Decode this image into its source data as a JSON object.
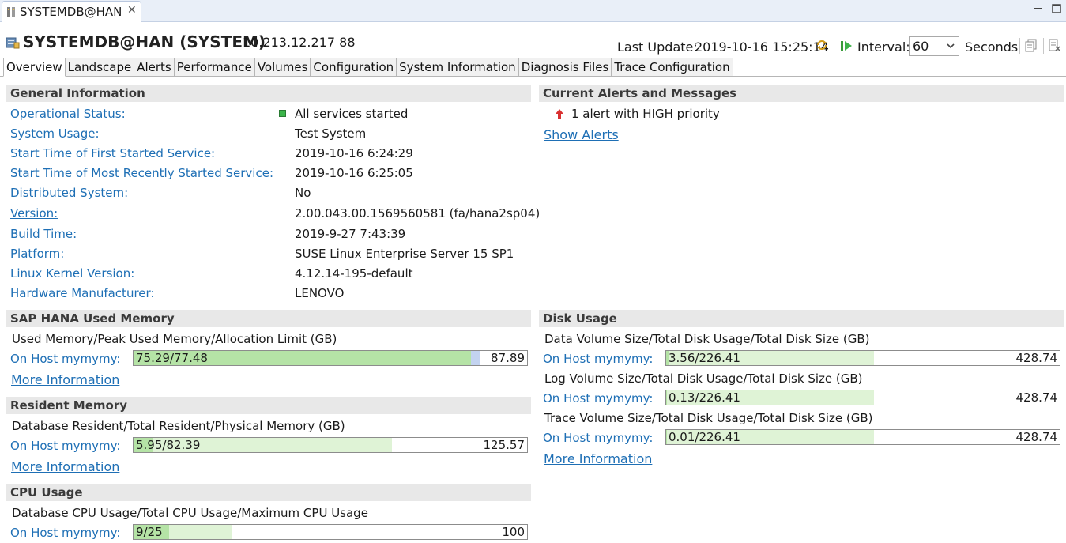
{
  "editor_tab": {
    "label": "SYSTEMDB@HAN",
    "close": "✕"
  },
  "header": {
    "title": "SYSTEMDB@HAN (SYSTEM)",
    "host": "10.213.12.217 88",
    "last_update_label": "Last Update:",
    "last_update_value": "2019-10-16 15:25:14",
    "interval_label": "Interval:",
    "interval_value": "60",
    "seconds_label": "Seconds"
  },
  "tabs": [
    {
      "label": "Overview"
    },
    {
      "label": "Landscape"
    },
    {
      "label": "Alerts"
    },
    {
      "label": "Performance"
    },
    {
      "label": "Volumes"
    },
    {
      "label": "Configuration"
    },
    {
      "label": "System Information"
    },
    {
      "label": "Diagnosis Files"
    },
    {
      "label": "Trace Configuration"
    }
  ],
  "general": {
    "title": "General Information",
    "rows": [
      {
        "label": "Operational Status:",
        "value": "All services started"
      },
      {
        "label": "System Usage:",
        "value": "Test System"
      },
      {
        "label": "Start Time of First Started Service:",
        "value": "2019-10-16 6:24:29"
      },
      {
        "label": "Start Time of Most Recently Started Service:",
        "value": "2019-10-16 6:25:05"
      },
      {
        "label": "Distributed System:",
        "value": "No"
      },
      {
        "label": "Version:",
        "value": "2.00.043.00.1569560581 (fa/hana2sp04)"
      },
      {
        "label": "Build Time:",
        "value": "2019-9-27 7:43:39"
      },
      {
        "label": "Platform:",
        "value": "SUSE Linux Enterprise Server 15 SP1"
      },
      {
        "label": "Linux Kernel Version:",
        "value": "4.12.14-195-default"
      },
      {
        "label": "Hardware Manufacturer:",
        "value": "LENOVO"
      }
    ]
  },
  "alerts": {
    "title": "Current Alerts and Messages",
    "message": "1 alert with HIGH priority",
    "show_alerts": "Show Alerts"
  },
  "memory": {
    "title": "SAP HANA Used Memory",
    "subtitle": "Used Memory/Peak Used Memory/Allocation Limit (GB)",
    "host_label": "On Host mymymy:",
    "bar_text": "75.29/77.48",
    "total": "87.89",
    "used_fraction": 0.8566,
    "peak_fraction": 0.8816,
    "more": "More Information"
  },
  "resident": {
    "title": "Resident Memory",
    "subtitle": "Database Resident/Total Resident/Physical Memory (GB)",
    "host_label": "On Host mymymy:",
    "bar_text": "5.95/82.39",
    "total": "125.57",
    "db_fraction": 0.0474,
    "total_fraction": 0.6561,
    "more": "More Information"
  },
  "cpu": {
    "title": "CPU Usage",
    "subtitle": "Database CPU Usage/Total CPU Usage/Maximum CPU Usage",
    "host_label": "On Host mymymy:",
    "bar_text": "9/25",
    "total": "100",
    "db_fraction": 0.09,
    "total_fraction": 0.25
  },
  "disk": {
    "title": "Disk Usage",
    "rows": [
      {
        "subtitle": "Data Volume Size/Total Disk Usage/Total Disk Size (GB)",
        "host_label": "On Host mymymy:",
        "bar_text": "3.56/226.41",
        "total": "428.74",
        "vol_fraction": 0.0083,
        "usage_fraction": 0.5281
      },
      {
        "subtitle": "Log Volume Size/Total Disk Usage/Total Disk Size (GB)",
        "host_label": "On Host mymymy:",
        "bar_text": "0.13/226.41",
        "total": "428.74",
        "vol_fraction": 0.0003,
        "usage_fraction": 0.5281
      },
      {
        "subtitle": "Trace Volume Size/Total Disk Usage/Total Disk Size (GB)",
        "host_label": "On Host mymymy:",
        "bar_text": "0.01/226.41",
        "total": "428.74",
        "vol_fraction": 2e-05,
        "usage_fraction": 0.5281
      }
    ],
    "more": "More Information"
  },
  "colors": {
    "link": "#1e6fb5",
    "used_fill": "#b5e3a6",
    "peak_fill": "#c3d3f0",
    "light_fill": "#dff3d6",
    "status_green": "#3bb54a",
    "alert_red": "#d93030"
  }
}
